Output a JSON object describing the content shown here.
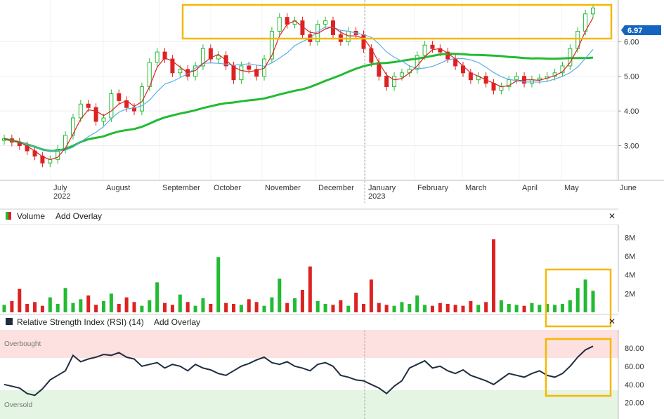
{
  "chart_data": [
    {
      "type": "candlestick",
      "title": "",
      "x_months": [
        "July",
        "August",
        "September",
        "October",
        "November",
        "December",
        "January",
        "February",
        "March",
        "April",
        "May",
        "June"
      ],
      "x_years": [
        "2022",
        "2023"
      ],
      "y_ticks": [
        "3.00",
        "4.00",
        "5.00",
        "6.00"
      ],
      "ylim": [
        2.0,
        7.2
      ],
      "last_price_label": "6.97",
      "close_series": [
        3.2,
        3.1,
        3.0,
        2.85,
        2.7,
        2.5,
        2.6,
        2.9,
        3.3,
        3.8,
        4.2,
        4.1,
        3.7,
        3.8,
        4.5,
        4.3,
        4.1,
        4.0,
        4.7,
        5.4,
        5.7,
        5.5,
        5.1,
        5.2,
        5.0,
        5.3,
        5.8,
        5.5,
        5.6,
        5.3,
        4.9,
        5.3,
        5.2,
        5.0,
        5.5,
        6.3,
        6.7,
        6.5,
        6.6,
        6.2,
        6.0,
        6.5,
        6.6,
        6.2,
        6.0,
        6.3,
        6.2,
        5.8,
        5.4,
        5.0,
        4.7,
        5.0,
        5.1,
        5.2,
        5.6,
        5.9,
        5.8,
        5.7,
        5.5,
        5.3,
        5.1,
        4.9,
        5.0,
        4.8,
        4.6,
        4.7,
        4.9,
        5.0,
        4.8,
        4.9,
        4.95,
        5.0,
        5.1,
        5.3,
        5.8,
        6.3,
        6.8,
        6.97
      ],
      "indicators": [
        {
          "name": "sma-long",
          "color": "#22bb33"
        },
        {
          "name": "sma-mid",
          "color": "#5aaee8"
        },
        {
          "name": "sma-short",
          "color": "#dd2222"
        }
      ]
    },
    {
      "type": "bar",
      "title": "Volume",
      "y_ticks": [
        "2M",
        "4M",
        "6M",
        "8M"
      ],
      "ylim": [
        0,
        9
      ],
      "values": [
        0.8,
        1.2,
        2.5,
        0.9,
        1.1,
        0.7,
        1.6,
        0.9,
        2.6,
        1.0,
        1.4,
        1.8,
        0.8,
        1.2,
        2.0,
        0.9,
        1.6,
        1.1,
        0.7,
        1.3,
        3.2,
        1.0,
        0.8,
        1.9,
        1.1,
        0.7,
        1.5,
        0.9,
        5.9,
        1.0,
        0.9,
        0.8,
        1.4,
        1.1,
        0.7,
        1.6,
        3.6,
        1.0,
        1.5,
        2.4,
        4.9,
        1.2,
        0.9,
        0.8,
        1.3,
        0.7,
        2.1,
        0.9,
        3.5,
        1.0,
        0.8,
        0.7,
        1.1,
        0.9,
        1.8,
        0.8,
        0.7,
        1.0,
        0.9,
        0.8,
        0.7,
        1.2,
        0.8,
        1.1,
        7.8,
        1.3,
        0.9,
        0.8,
        0.7,
        1.0,
        0.8,
        0.9,
        0.8,
        0.9,
        1.3,
        2.6,
        3.5,
        2.3
      ]
    },
    {
      "type": "line",
      "title": "Relative Strength Index (RSI) (14)",
      "y_ticks": [
        "20.00",
        "40.00",
        "60.00",
        "80.00"
      ],
      "ylim": [
        2,
        100
      ],
      "zones": {
        "overbought": "Overbought",
        "oversold": "Oversold"
      },
      "values": [
        40,
        38,
        36,
        30,
        28,
        35,
        45,
        50,
        55,
        72,
        65,
        68,
        70,
        73,
        72,
        75,
        70,
        68,
        60,
        62,
        64,
        58,
        62,
        60,
        55,
        62,
        58,
        56,
        52,
        50,
        55,
        60,
        63,
        67,
        70,
        64,
        62,
        65,
        60,
        58,
        55,
        62,
        64,
        60,
        50,
        48,
        45,
        44,
        40,
        36,
        30,
        38,
        44,
        58,
        62,
        66,
        58,
        60,
        55,
        52,
        56,
        50,
        47,
        44,
        40,
        46,
        52,
        50,
        48,
        52,
        55,
        50,
        48,
        52,
        60,
        70,
        78,
        82
      ]
    }
  ],
  "panels": {
    "volume": {
      "title": "Volume",
      "add_overlay": "Add Overlay",
      "close": "✕"
    },
    "rsi": {
      "title": "Relative Strength Index (RSI) (14)",
      "add_overlay": "Add Overlay",
      "close": "✕"
    }
  },
  "colors": {
    "up": "#22bb33",
    "down": "#dd2222",
    "highlight": "#f5b800",
    "price_tag": "#1565c0",
    "rsi_line": "#1f2d40",
    "overbought_zone": "#fde0e0",
    "oversold_zone": "#e4f5e4"
  }
}
